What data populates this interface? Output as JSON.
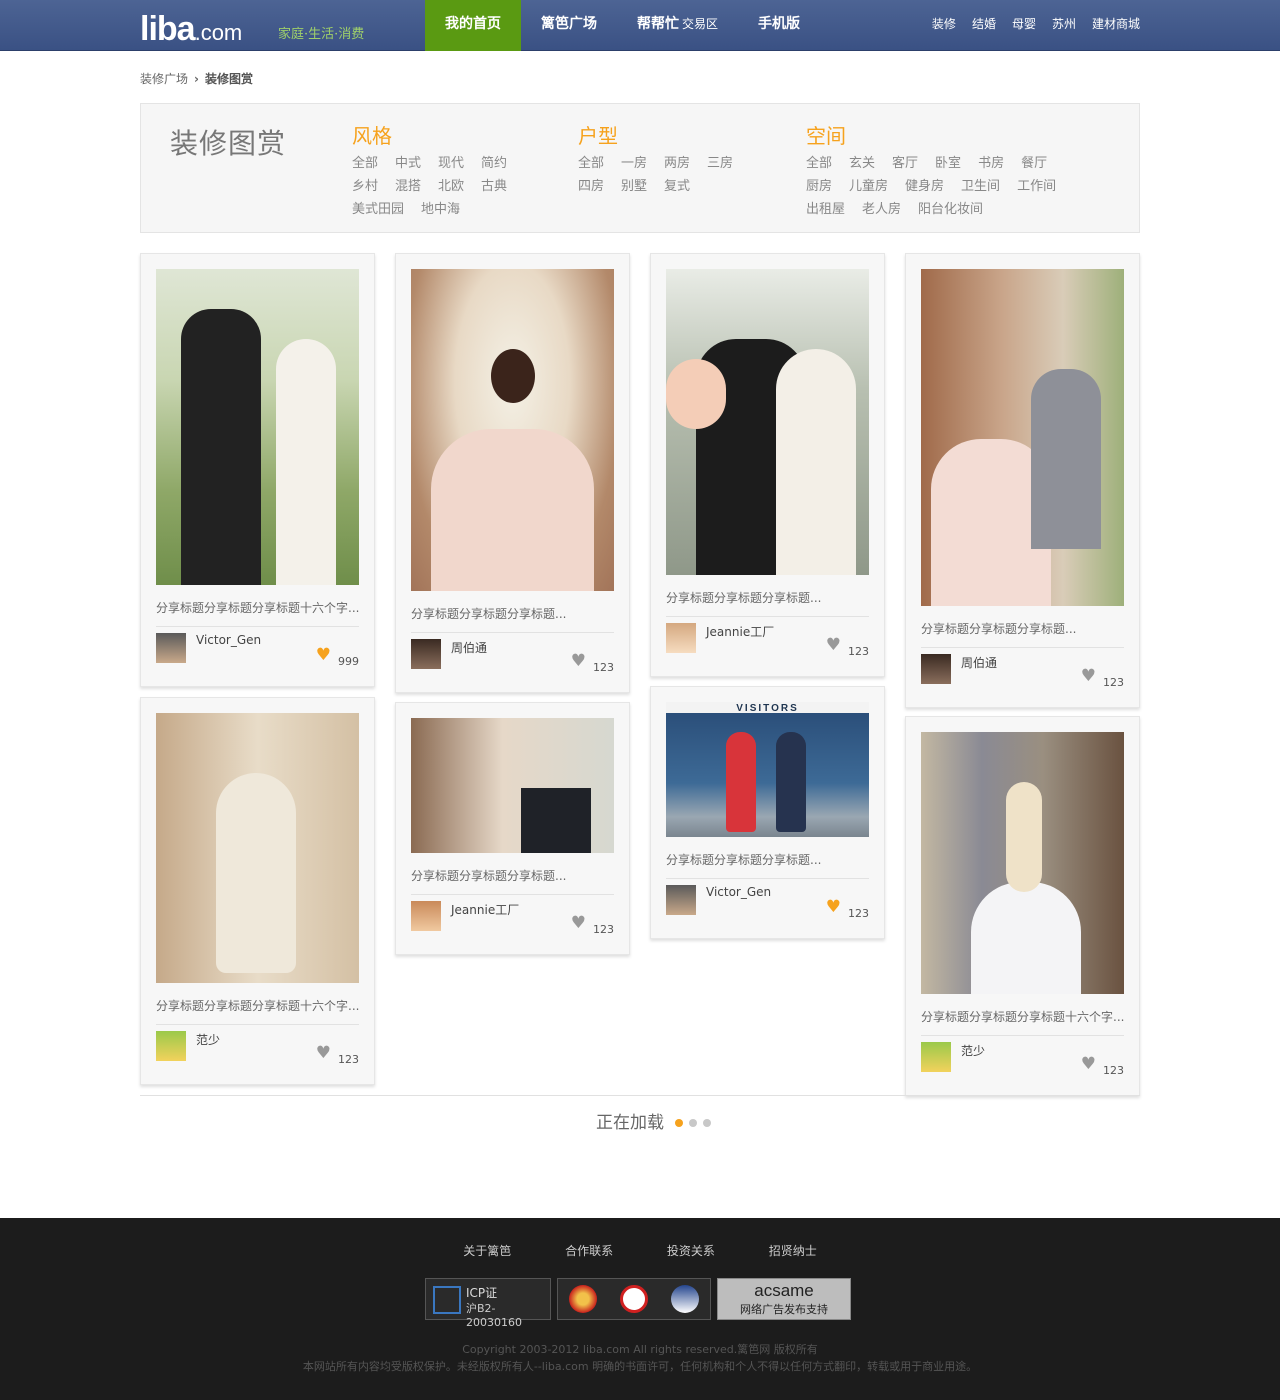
{
  "header": {
    "logo_main": "liba",
    "logo_domain": ".com",
    "slogan": "家庭·生活·消费",
    "nav": [
      {
        "label": "我的首页",
        "sub": ""
      },
      {
        "label": "篱笆广场",
        "sub": ""
      },
      {
        "label": "帮帮忙",
        "sub": "交易区"
      },
      {
        "label": "手机版",
        "sub": ""
      }
    ],
    "subnav": [
      "装修",
      "结婚",
      "母婴",
      "苏州",
      "建材商城"
    ]
  },
  "breadcrumb": {
    "parent": "装修广场",
    "current": "装修图赏"
  },
  "filter": {
    "title": "装修图赏",
    "groups": [
      {
        "title": "风格",
        "rows": [
          [
            "全部",
            "中式",
            "现代",
            "简约"
          ],
          [
            "乡村",
            "混搭",
            "北欧",
            "古典"
          ],
          [
            "美式田园",
            "地中海"
          ]
        ]
      },
      {
        "title": "户型",
        "rows": [
          [
            "全部",
            "一房",
            "两房",
            "三房"
          ],
          [
            "四房",
            "别墅",
            "复式"
          ]
        ]
      },
      {
        "title": "空间",
        "rows": [
          [
            "全部",
            "玄关",
            "客厅",
            "卧室",
            "书房",
            "餐厅"
          ],
          [
            "厨房",
            "儿童房",
            "健身房",
            "卫生间",
            "工作间"
          ],
          [
            "出租屋",
            "老人房",
            "阳台化妆间"
          ]
        ]
      }
    ]
  },
  "cards": [
    {
      "title": "分享标题分享标题分享标题十六个字...",
      "user": "Victor_Gen",
      "count": "999",
      "liked": true
    },
    {
      "title": "分享标题分享标题分享标题...",
      "user": "周伯通",
      "count": "123",
      "liked": false
    },
    {
      "title": "分享标题分享标题分享标题...",
      "user": "Jeannie工厂",
      "count": "123",
      "liked": false
    },
    {
      "title": "分享标题分享标题分享标题...",
      "user": "周伯通",
      "count": "123",
      "liked": false
    },
    {
      "title": "分享标题分享标题分享标题十六个字...",
      "user": "范少",
      "count": "123",
      "liked": false
    },
    {
      "title": "分享标题分享标题分享标题...",
      "user": "Jeannie工厂",
      "count": "123",
      "liked": false
    },
    {
      "title": "分享标题分享标题分享标题...",
      "user": "Victor_Gen",
      "count": "123",
      "liked": true
    },
    {
      "title": "分享标题分享标题分享标题十六个字...",
      "user": "范少",
      "count": "123",
      "liked": false
    }
  ],
  "photo_sign": "VISITORS",
  "loading": "正在加载",
  "footer": {
    "links": [
      "关于篱笆",
      "合作联系",
      "投资关系",
      "招贤纳士"
    ],
    "icp_title": "ICP证",
    "icp_no": "沪B2-20030160",
    "acs_title": "acsame",
    "acs_sub": "网络广告发布支持",
    "copyright1": "Copyright 2003-2012 liba.com All rights reserved.篱笆网 版权所有",
    "copyright2": "本网站所有内容均受版权保护。未经版权所有人--liba.com 明确的书面许可，任何机构和个人不得以任何方式翻印，转载或用于商业用途。"
  }
}
